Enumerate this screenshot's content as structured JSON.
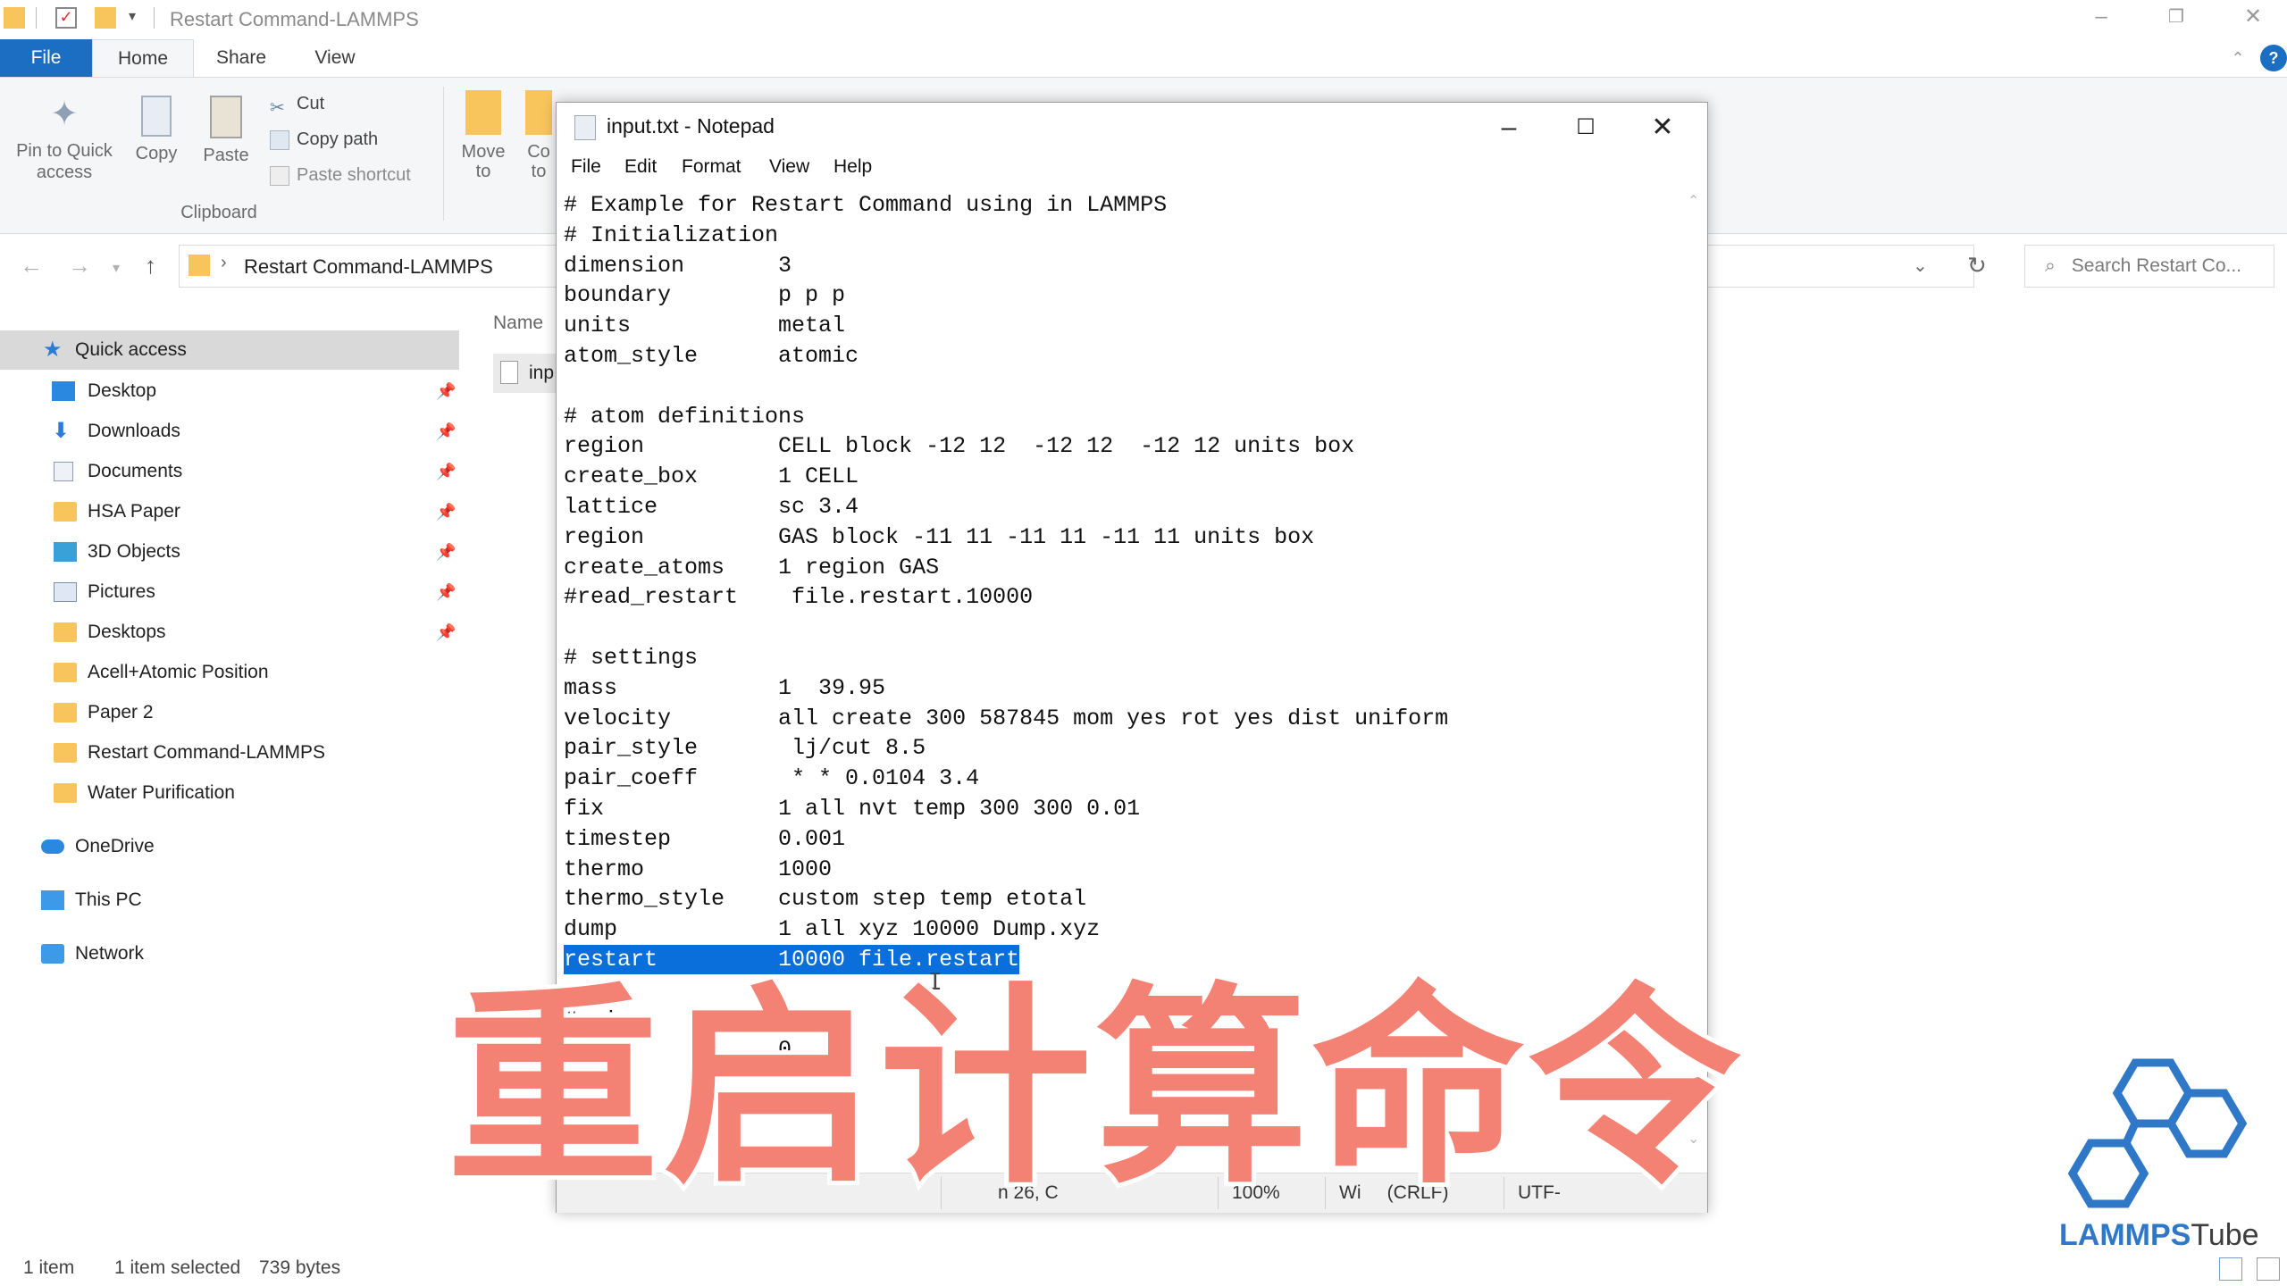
{
  "explorer": {
    "title": "Restart Command-LAMMPS",
    "tabs": {
      "file": "File",
      "home": "Home",
      "share": "Share",
      "view": "View"
    },
    "ribbon": {
      "pin": "Pin to Quick access",
      "copy": "Copy",
      "paste": "Paste",
      "cut": "Cut",
      "copy_path": "Copy path",
      "paste_shortcut": "Paste shortcut",
      "clipboard_group": "Clipboard",
      "move_to": "Move to",
      "copy_to_partial": "Co to"
    },
    "address": {
      "crumb": "Restart Command-LAMMPS"
    },
    "search": {
      "placeholder": "Search Restart Co..."
    },
    "nav": {
      "quick_access": "Quick access",
      "items": [
        {
          "label": "Desktop",
          "icon": "desktop-icon"
        },
        {
          "label": "Downloads",
          "icon": "downloads-icon"
        },
        {
          "label": "Documents",
          "icon": "documents-icon"
        },
        {
          "label": "HSA Paper",
          "icon": "folder-icon"
        },
        {
          "label": "3D Objects",
          "icon": "3d-objects-icon"
        },
        {
          "label": "Pictures",
          "icon": "pictures-icon"
        },
        {
          "label": "Desktops",
          "icon": "folder-icon"
        },
        {
          "label": "Acell+Atomic Position",
          "icon": "folder-icon"
        },
        {
          "label": "Paper 2",
          "icon": "folder-icon"
        },
        {
          "label": "Restart Command-LAMMPS",
          "icon": "folder-icon"
        },
        {
          "label": "Water Purification",
          "icon": "folder-icon"
        }
      ],
      "onedrive": "OneDrive",
      "this_pc": "This PC",
      "network": "Network"
    },
    "content": {
      "column_name": "Name",
      "file_partial": "inp"
    },
    "status": {
      "count": "1 item",
      "selected": "1 item selected",
      "size": "739 bytes"
    }
  },
  "notepad": {
    "title": "input.txt - Notepad",
    "menu": {
      "file": "File",
      "edit": "Edit",
      "format": "Format",
      "view": "View",
      "help": "Help"
    },
    "lines": [
      "# Example for Restart Command using in LAMMPS",
      "# Initialization",
      "dimension       3",
      "boundary        p p p",
      "units           metal",
      "atom_style      atomic",
      "",
      "# atom definitions",
      "region          CELL block -12 12  -12 12  -12 12 units box",
      "create_box      1 CELL",
      "lattice         sc 3.4",
      "region          GAS block -11 11 -11 11 -11 11 units box",
      "create_atoms    1 region GAS",
      "#read_restart    file.restart.10000",
      "",
      "# settings",
      "mass            1  39.95",
      "velocity        all create 300 587845 mom yes rot yes dist uniform",
      "pair_style       lj/cut 8.5",
      "pair_coeff       * * 0.0104 3.4",
      "fix             1 all nvt temp 300 300 0.01",
      "timestep        0.001",
      "thermo          1000",
      "thermo_style    custom step temp etotal",
      "dump            1 all xyz 10000 Dump.xyz",
      "restart         10000 file.restart",
      "",
      "# si",
      "                0"
    ],
    "selected_line_index": 25,
    "status": {
      "position_partial": "n 26, C",
      "zoom": "100%",
      "line_ending": "Wi     (CRLF)",
      "encoding": "UTF-"
    }
  },
  "overlay": {
    "caption": "重启计算命令"
  },
  "logo": {
    "brand": "LAMMPS",
    "suffix": "Tube"
  }
}
